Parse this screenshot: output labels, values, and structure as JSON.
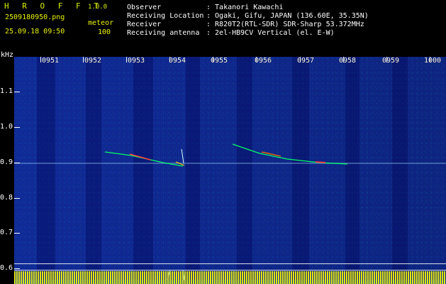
{
  "header": {
    "brand": "H R O F F T",
    "version": "1.0.0",
    "filename": "2509180950.png",
    "datetime": "25.09.18 09:50",
    "mode": "meteor",
    "count": "100",
    "observer_label": "Observer",
    "observer_value": ": Takanori Kawachi",
    "location_label": "Receiving Location",
    "location_value": ": Ogaki, Gifu, JAPAN (136.60E, 35.35N)",
    "receiver_label": "Receiver",
    "receiver_value": ": R820T2(RTL-SDR) SDR-Sharp 53.372MHz",
    "antenna_label": "Receiving antenna",
    "antenna_value": ": 2el-HB9CV Vertical (el. E-W)"
  },
  "axis": {
    "unit": "kHz",
    "time_labels": [
      "0951",
      "0952",
      "0953",
      "0954",
      "0955",
      "0956",
      "0957",
      "0958",
      "0959",
      "1000"
    ],
    "freq_labels": [
      "1.1",
      "1.0",
      "0.9",
      "0.8",
      "0.7",
      "0.6"
    ]
  },
  "colors": {
    "background": "#000000",
    "plot_blue": "#102b9f",
    "accent_yellow": "#ffff00",
    "meteor_green": "#00ff66",
    "meteor_red": "#ff3b3b",
    "meteor_cyan": "#00e5ff"
  }
}
